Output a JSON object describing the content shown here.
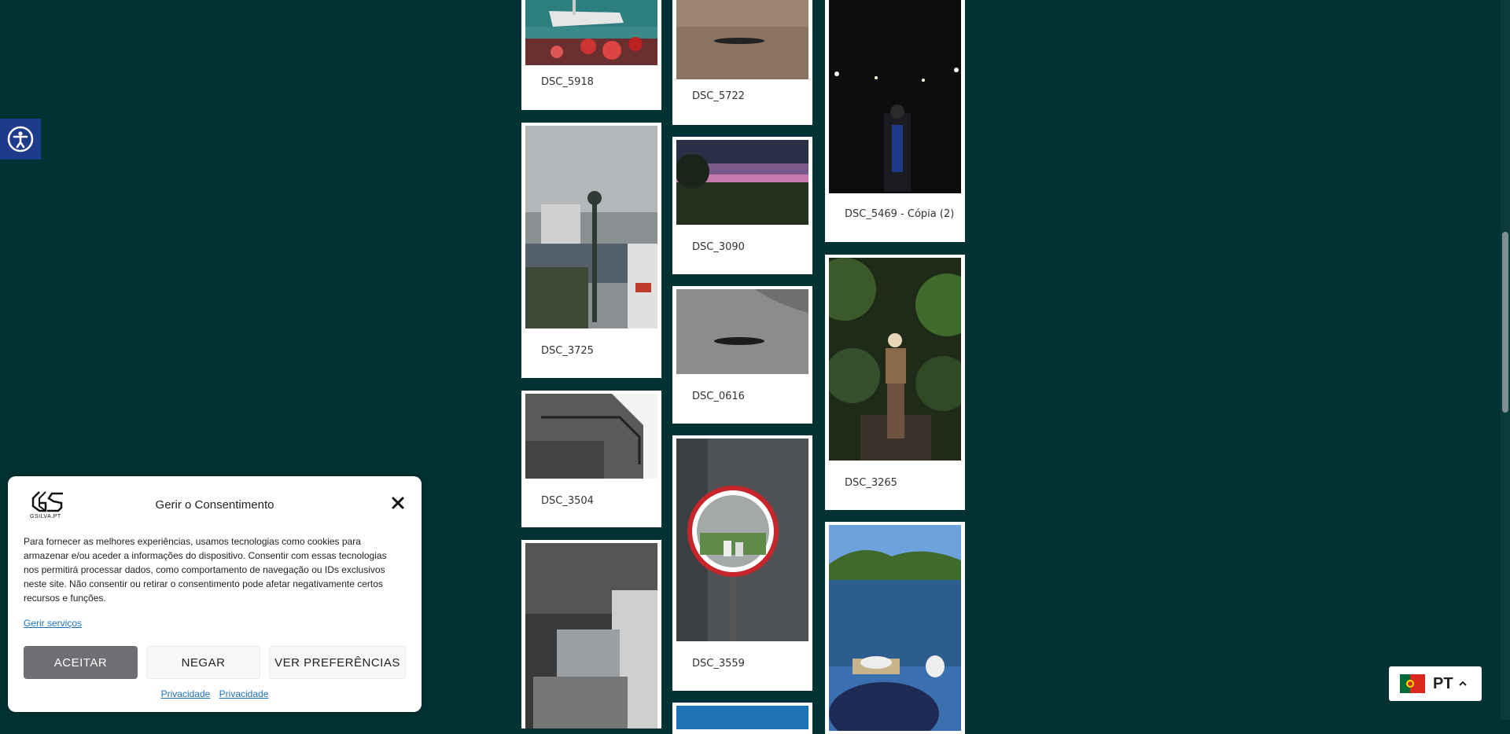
{
  "gallery": {
    "items": [
      {
        "caption": "DSC_5918"
      },
      {
        "caption": "DSC_5722"
      },
      {
        "caption": "DSC_5469 - Cópia (2)"
      },
      {
        "caption": "DSC_3725"
      },
      {
        "caption": "DSC_3090"
      },
      {
        "caption": "DSC_0616"
      },
      {
        "caption": "DSC_3265"
      },
      {
        "caption": "DSC_3504"
      },
      {
        "caption": "DSC_3559"
      }
    ]
  },
  "consent": {
    "logo_text": "GSILVA.PT",
    "title": "Gerir o Consentimento",
    "message": "Para fornecer as melhores experiências, usamos tecnologias como cookies para armazenar e/ou aceder a informações do dispositivo. Consentir com essas tecnologias nos permitirá processar dados, como comportamento de navegação ou IDs exclusivos neste site. Não consentir ou retirar o consentimento pode afetar negativamente certos recursos e funções.",
    "manage_link": "Gerir serviços",
    "accept_label": "ACEITAR",
    "deny_label": "NEGAR",
    "preferences_label": "VER PREFERÊNCIAS",
    "privacy_link_1": "Privacidade",
    "privacy_link_2": "Privacidade"
  },
  "language": {
    "code": "PT",
    "flag": "portugal-flag-icon"
  },
  "colors": {
    "background": "#023233",
    "accessibility_button": "#1e3a8a",
    "accept_button": "#6e6e73",
    "link": "#1e73be"
  }
}
